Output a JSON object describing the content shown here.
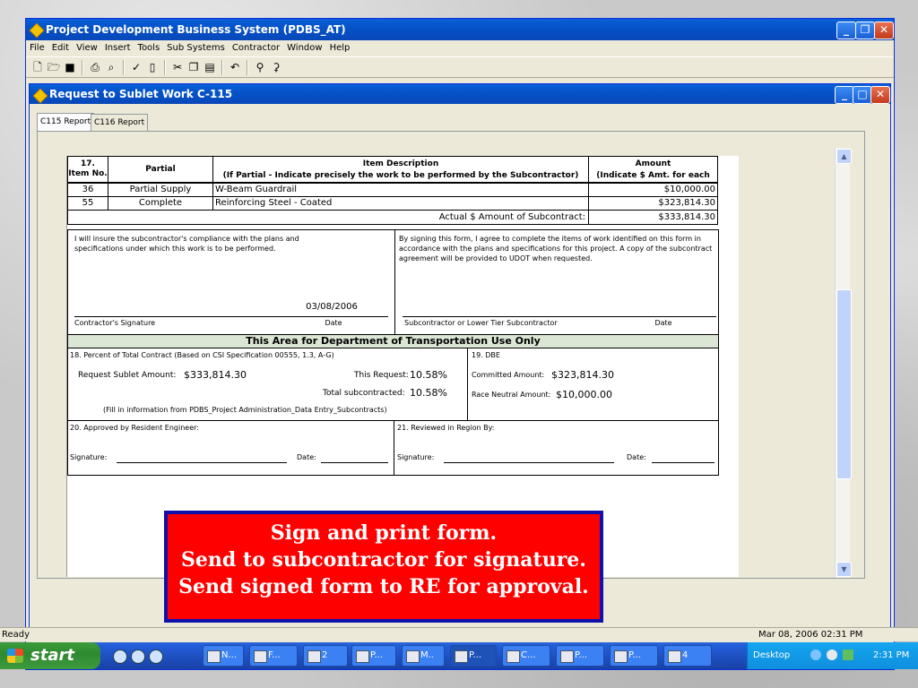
{
  "app": {
    "title": "Project Development Business System (PDBS_AT)",
    "menu": [
      "File",
      "Edit",
      "View",
      "Insert",
      "Tools",
      "Sub Systems",
      "Contractor",
      "Window",
      "Help"
    ],
    "toolbar_icons": [
      "new-icon",
      "open-icon",
      "save-icon",
      "print-icon",
      "print-preview-icon",
      "spell-icon",
      "form-icon",
      "cut-icon",
      "copy-icon",
      "paste-icon",
      "undo-icon",
      "find-icon",
      "replace-icon"
    ]
  },
  "child": {
    "title": "Request to Sublet Work C-115",
    "tabs": [
      {
        "label": "C115 Report",
        "active": true
      },
      {
        "label": "C116 Report",
        "active": false
      }
    ]
  },
  "report": {
    "headers": {
      "item_no": "17.\nItem No.",
      "partial": "Partial",
      "desc_title": "Item Description",
      "desc_sub": "(If Partial - Indicate precisely the work to be performed by the Subcontractor)",
      "amount_title": "Amount",
      "amount_sub": "(Indicate $ Amt. for each"
    },
    "rows": [
      {
        "item": "36",
        "partial": "Partial Supply",
        "desc": "W-Beam Guardrail",
        "amount": "$10,000.00"
      },
      {
        "item": "55",
        "partial": "Complete",
        "desc": "Reinforcing Steel - Coated",
        "amount": "$323,814.30"
      }
    ],
    "actual_label": "Actual $ Amount of Subcontract:",
    "actual_value": "$333,814.30",
    "left_statement": "I will insure the subcontractor's compliance with the plans and specifications under which this work is to be performed.",
    "right_statement": "By signing this form, I agree to complete the items of work identified on this form in accordance with the plans and specifications for this project.  A copy of the subcontract agreement will be provided to UDOT when requested.",
    "sig_date": "03/08/2006",
    "contractor_sig_label": "Contractor's Signature",
    "date_label": "Date",
    "sub_sig_label": "Subcontractor or Lower Tier Subcontractor",
    "dot_bar": "This Area for Department of Transportation Use Only",
    "percent_label": "18. Percent of Total Contract (Based on CSI Specification 00555, 1.3, A-G)",
    "request_sublet_label": "Request Sublet Amount:",
    "request_sublet_value": "$333,814.30",
    "this_request_label": "This Request:",
    "this_request_value": "10.58%",
    "total_sub_label": "Total subcontracted:",
    "total_sub_value": "10.58%",
    "fill_info": "(Fill in information from PDBS_Project Administration_Data Entry_Subcontracts)",
    "dbe_label": "19. DBE",
    "committed_label": "Committed Amount:",
    "committed_value": "$323,814.30",
    "race_neutral_label": "Race Neutral Amount:",
    "race_neutral_value": "$10,000.00",
    "approved_label": "20. Approved by Resident Engineer:",
    "reviewed_label": "21. Reviewed in Region By:",
    "signature_label": "Signature:",
    "date_colon_label": "Date:"
  },
  "note": {
    "line1": "Sign and print form.",
    "line2": "Send to subcontractor for signature.",
    "line3": "Send signed form to RE for approval."
  },
  "status": {
    "text": "Ready",
    "datetime": "Mar 08, 2006 02:31 PM"
  },
  "taskbar": {
    "start": "start",
    "items": [
      "N...",
      "F...",
      "2",
      "P...",
      "M..",
      "P...",
      "C...",
      "P...",
      "P...",
      "4"
    ],
    "desktop": "Desktop",
    "clock": "2:31 PM"
  }
}
